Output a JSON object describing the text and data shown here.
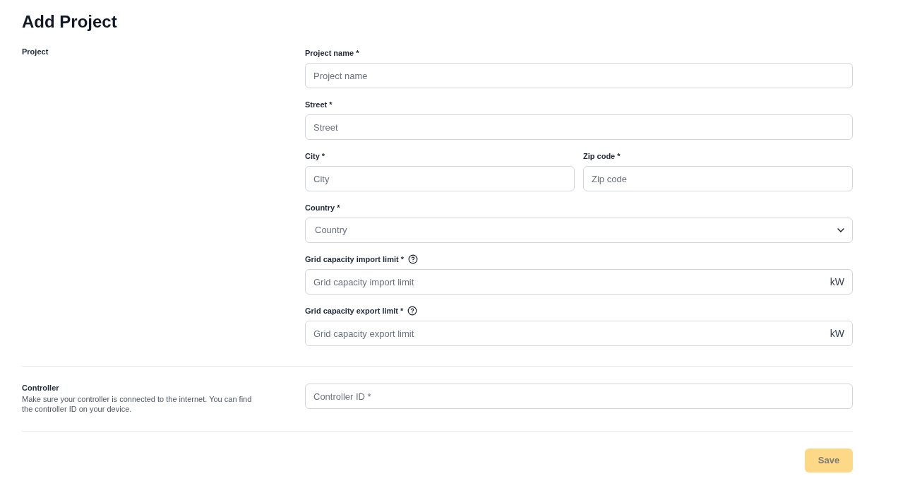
{
  "title": "Add Project",
  "sections": [
    {
      "title": "Project",
      "rows": [
        {
          "fields": [
            {
              "kind": "text",
              "label": "Project name *",
              "placeholder": "Project name"
            }
          ]
        },
        {
          "fields": [
            {
              "kind": "text",
              "label": "Street *",
              "placeholder": "Street"
            }
          ]
        },
        {
          "fields": [
            {
              "kind": "text",
              "label": "City *",
              "placeholder": "City"
            },
            {
              "kind": "text",
              "label": "Zip code *",
              "placeholder": "Zip code"
            }
          ]
        },
        {
          "fields": [
            {
              "kind": "select",
              "label": "Country *",
              "placeholder": "Country"
            }
          ]
        },
        {
          "fields": [
            {
              "kind": "unit",
              "label": "Grid capacity import limit *",
              "help": true,
              "placeholder": "Grid capacity import limit",
              "unit": "kW"
            }
          ]
        },
        {
          "fields": [
            {
              "kind": "unit",
              "label": "Grid capacity export limit *",
              "help": true,
              "placeholder": "Grid capacity export limit",
              "unit": "kW"
            }
          ]
        }
      ]
    },
    {
      "title": "Controller",
      "description": "Make sure your controller is connected to the internet. You can find the controller ID on your device.",
      "rows": [
        {
          "fields": [
            {
              "kind": "text",
              "placeholder": "Controller ID *"
            }
          ]
        }
      ]
    }
  ],
  "save_button": {
    "label": "Save",
    "disabled": true
  }
}
